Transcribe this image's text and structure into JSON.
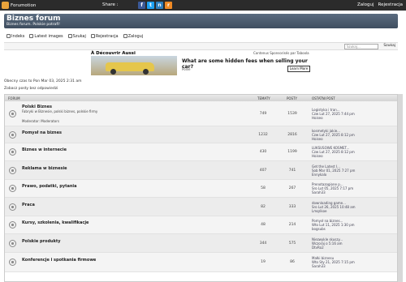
{
  "topbar": {
    "brand": "Forumotion",
    "share_label": "Share :",
    "social": [
      {
        "icon": "facebook-icon",
        "glyph": "f",
        "color": "#3b5998"
      },
      {
        "icon": "twitter-icon",
        "glyph": "t",
        "color": "#1da1f2"
      },
      {
        "icon": "netvibes-icon",
        "glyph": "n",
        "color": "#2e7fbd"
      },
      {
        "icon": "rss-icon",
        "glyph": "r",
        "color": "#f08a24"
      }
    ],
    "login": "Zaloguj",
    "register": "Rejestracja"
  },
  "header": {
    "title": "Biznes forum",
    "tagline": "Biznes forum. Polskie potrafi!"
  },
  "nav": [
    {
      "label": "Indeks",
      "name": "nav-index"
    },
    {
      "label": "Latest images",
      "name": "nav-latest-images"
    },
    {
      "label": "Szukaj",
      "name": "nav-search"
    },
    {
      "label": "Rejestracja",
      "name": "nav-register"
    },
    {
      "label": "Zaloguj",
      "name": "nav-login"
    }
  ],
  "search": {
    "placeholder": "Szukaj...",
    "button": "Szukaj"
  },
  "ad": {
    "title": "À Découvrir Aussi",
    "sponsor": "Contenus Sponsorisés par Taboola",
    "headline": "What are some hidden fees when selling your car?",
    "source": "Pollie",
    "cta": "Learn More"
  },
  "info": {
    "date": "Obecny czas to Pon Mar 03, 2025 2:31 am",
    "unanswered": "Zobacz posty bez odpowiedzi"
  },
  "table": {
    "col_forum": "FORUM",
    "col_topics": "TEMATY",
    "col_posts": "POSTY",
    "col_last": "OSTATNI POST"
  },
  "forums": [
    {
      "name": "Polski Biznes",
      "desc": "Fabryki w Biznesie, polski biznes, polskie firmy",
      "mod": "Moderator: Moderators",
      "topics": "749",
      "posts": "1539",
      "last1": "Logistyka i tran...",
      "last2": "Czw Lut 27, 2025 7:44 pm",
      "last3": "Hoiseo"
    },
    {
      "name": "Pomysł na biznes",
      "desc": "",
      "mod": "",
      "topics": "1232",
      "posts": "2816",
      "last1": "kosmetyki jakie...",
      "last2": "Czw Lut 27, 2025 8:12 pm",
      "last3": "Hoiseo"
    },
    {
      "name": "Biznes w internecie",
      "desc": "",
      "mod": "",
      "topics": "430",
      "posts": "1199",
      "last1": "LUKSUSOWE KOSMET...",
      "last2": "Czw Lut 27, 2025 8:12 pm",
      "last3": "Hoiseo"
    },
    {
      "name": "Reklama w biznesie",
      "desc": "",
      "mod": "",
      "topics": "407",
      "posts": "741",
      "last1": "Get the Latest I...",
      "last2": "Sob Mar 01, 2025 7:27 pm",
      "last3": "Ennykalo"
    },
    {
      "name": "Prawo, podatki, pytania",
      "desc": "",
      "mod": "",
      "topics": "58",
      "posts": "267",
      "last1": "Prenotazogione p...",
      "last2": "Sro Lut 05, 2025 7:17 pm",
      "last3": "Sarah33"
    },
    {
      "name": "Praca",
      "desc": "",
      "mod": "",
      "topics": "82",
      "posts": "333",
      "last1": "downloading game...",
      "last2": "Sro Lut 26, 2025 10:48 am",
      "last3": "Lmqrikoe"
    },
    {
      "name": "Kursy, szkolenia, kwalifikacje",
      "desc": "",
      "mod": "",
      "topics": "48",
      "posts": "214",
      "last1": "Pomysł na biznes...",
      "last2": "Wto Lut 11, 2025 1:30 pm",
      "last3": "bogsubs"
    },
    {
      "name": "Polskie produkty",
      "desc": "",
      "mod": "",
      "topics": "344",
      "posts": "575",
      "last1": "Niezwykle skuszy...",
      "last2": "Wczoraj o 5:16 am",
      "last3": "DtvRo2"
    },
    {
      "name": "Konferencje i spotkania firmowe",
      "desc": "",
      "mod": "",
      "topics": "19",
      "posts": "86",
      "last1": "Małki biznesu",
      "last2": "Wto Sty 21, 2025 7:15 pm",
      "last3": "Sarah33"
    }
  ]
}
